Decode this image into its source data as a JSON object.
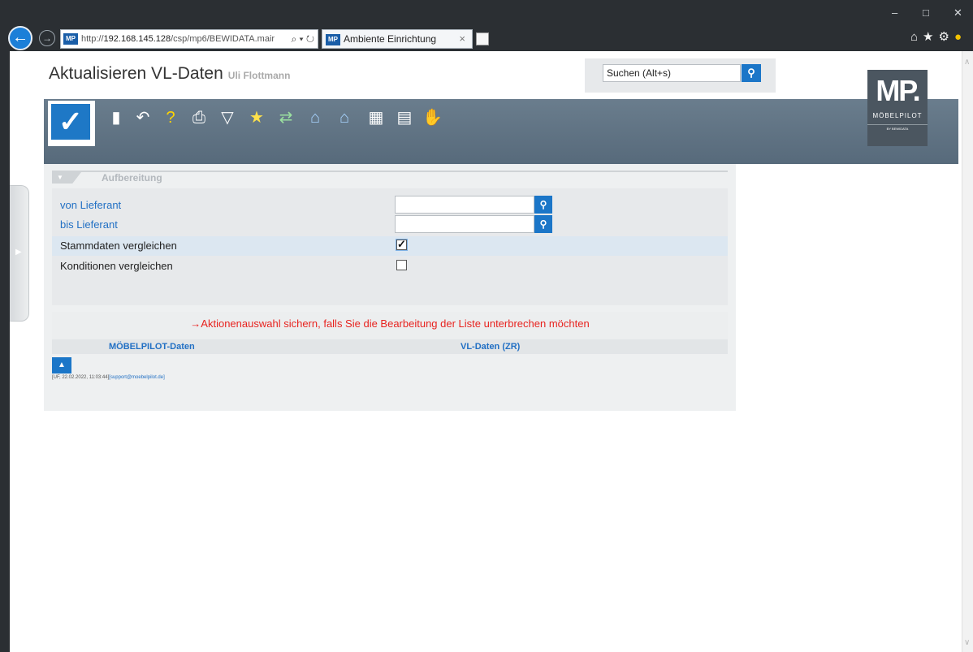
{
  "browser": {
    "address_prefix": "http://",
    "address_host": "192.168.145.128",
    "address_path": "/csp/mp6/BEWIDATA.mair",
    "address_tools": "⌕ ▾ ↻",
    "favicon": "MP",
    "tab_title": "Ambiente Einrichtung",
    "tab_close": "×"
  },
  "app": {
    "title": "Aktualisieren VL-Daten",
    "user": "Uli Flottmann",
    "search_placeholder": "Suchen (Alt+s)",
    "logo_text": "MP.",
    "logo_name": "MÖBELPILOT",
    "logo_sub": "BY BEWIDATA"
  },
  "section": {
    "title": "Aufbereitung"
  },
  "form": {
    "von_lieferant_label": "von Lieferant",
    "bis_lieferant_label": "bis Lieferant",
    "stammdaten_label": "Stammdaten vergleichen",
    "stammdaten_checked": "✓",
    "konditionen_label": "Konditionen vergleichen",
    "konditionen_checked": ""
  },
  "warning": "→Aktionenauswahl sichern, falls Sie die Bearbeitung der Liste unterbrechen möchten",
  "table": {
    "col1": "MÖBELPILOT-Daten",
    "col2": "VL-Daten (ZR)"
  },
  "footer": {
    "info": "[UF, 22.02.2022, 11:03:44]",
    "email": "[support@moebelpilot.de]"
  }
}
